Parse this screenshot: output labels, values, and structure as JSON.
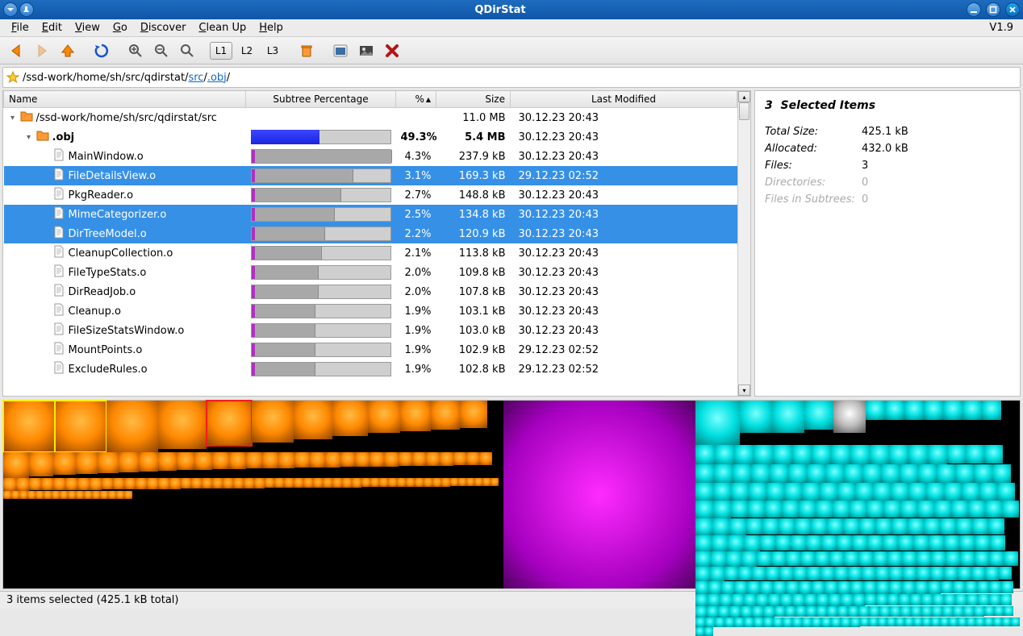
{
  "window": {
    "title": "QDirStat",
    "version": "V1.9"
  },
  "menu": {
    "file": "File",
    "edit": "Edit",
    "view": "View",
    "go": "Go",
    "discover": "Discover",
    "cleanup": "Clean Up",
    "help": "Help"
  },
  "toolbar": {
    "levels": {
      "l1": "L1",
      "l2": "L2",
      "l3": "L3"
    }
  },
  "breadcrumb": {
    "prefix": "/ssd-work/home/sh/src/qdirstat/",
    "link1": "src",
    "link2": ".obj",
    "trail": "/"
  },
  "columns": {
    "name": "Name",
    "subtree": "Subtree Percentage",
    "pct": "%",
    "size": "Size",
    "modified": "Last Modified"
  },
  "rows": [
    {
      "depth": 0,
      "expander": "down",
      "icon": "folder",
      "bold": false,
      "sel": false,
      "name": "/ssd-work/home/sh/src/qdirstat/src",
      "bar": null,
      "pct": "",
      "size": "11.0 MB",
      "mod": "30.12.23 20:43"
    },
    {
      "depth": 1,
      "expander": "down",
      "icon": "folder",
      "bold": true,
      "sel": false,
      "name": ".obj",
      "bar": {
        "type": "blue",
        "width": 49.3
      },
      "pct": "49.3%",
      "size": "5.4 MB",
      "mod": "30.12.23 20:43"
    },
    {
      "depth": 2,
      "expander": "",
      "icon": "file",
      "bold": false,
      "sel": false,
      "name": "MainWindow.o",
      "bar": {
        "type": "pg",
        "width": 4.3
      },
      "pct": "4.3%",
      "size": "237.9 kB",
      "mod": "30.12.23 20:43"
    },
    {
      "depth": 2,
      "expander": "",
      "icon": "file",
      "bold": false,
      "sel": true,
      "name": "FileDetailsView.o",
      "bar": {
        "type": "pg",
        "width": 3.1
      },
      "pct": "3.1%",
      "size": "169.3 kB",
      "mod": "29.12.23 02:52"
    },
    {
      "depth": 2,
      "expander": "",
      "icon": "file",
      "bold": false,
      "sel": false,
      "name": "PkgReader.o",
      "bar": {
        "type": "pg",
        "width": 2.7
      },
      "pct": "2.7%",
      "size": "148.8 kB",
      "mod": "30.12.23 20:43"
    },
    {
      "depth": 2,
      "expander": "",
      "icon": "file",
      "bold": false,
      "sel": true,
      "name": "MimeCategorizer.o",
      "bar": {
        "type": "pg",
        "width": 2.5
      },
      "pct": "2.5%",
      "size": "134.8 kB",
      "mod": "30.12.23 20:43"
    },
    {
      "depth": 2,
      "expander": "",
      "icon": "file",
      "bold": false,
      "sel": true,
      "name": "DirTreeModel.o",
      "bar": {
        "type": "pg",
        "width": 2.2
      },
      "pct": "2.2%",
      "size": "120.9 kB",
      "mod": "30.12.23 20:43"
    },
    {
      "depth": 2,
      "expander": "",
      "icon": "file",
      "bold": false,
      "sel": false,
      "name": "CleanupCollection.o",
      "bar": {
        "type": "pg",
        "width": 2.1
      },
      "pct": "2.1%",
      "size": "113.8 kB",
      "mod": "30.12.23 20:43"
    },
    {
      "depth": 2,
      "expander": "",
      "icon": "file",
      "bold": false,
      "sel": false,
      "name": "FileTypeStats.o",
      "bar": {
        "type": "pg",
        "width": 2.0
      },
      "pct": "2.0%",
      "size": "109.8 kB",
      "mod": "30.12.23 20:43"
    },
    {
      "depth": 2,
      "expander": "",
      "icon": "file",
      "bold": false,
      "sel": false,
      "name": "DirReadJob.o",
      "bar": {
        "type": "pg",
        "width": 2.0
      },
      "pct": "2.0%",
      "size": "107.8 kB",
      "mod": "30.12.23 20:43"
    },
    {
      "depth": 2,
      "expander": "",
      "icon": "file",
      "bold": false,
      "sel": false,
      "name": "Cleanup.o",
      "bar": {
        "type": "pg",
        "width": 1.9
      },
      "pct": "1.9%",
      "size": "103.1 kB",
      "mod": "30.12.23 20:43"
    },
    {
      "depth": 2,
      "expander": "",
      "icon": "file",
      "bold": false,
      "sel": false,
      "name": "FileSizeStatsWindow.o",
      "bar": {
        "type": "pg",
        "width": 1.9
      },
      "pct": "1.9%",
      "size": "103.0 kB",
      "mod": "30.12.23 20:43"
    },
    {
      "depth": 2,
      "expander": "",
      "icon": "file",
      "bold": false,
      "sel": false,
      "name": "MountPoints.o",
      "bar": {
        "type": "pg",
        "width": 1.9
      },
      "pct": "1.9%",
      "size": "102.9 kB",
      "mod": "29.12.23 02:52"
    },
    {
      "depth": 2,
      "expander": "",
      "icon": "file",
      "bold": false,
      "sel": false,
      "name": "ExcludeRules.o",
      "bar": {
        "type": "pg",
        "width": 1.9
      },
      "pct": "1.9%",
      "size": "102.8 kB",
      "mod": "29.12.23 02:52"
    }
  ],
  "details": {
    "title_count": "3",
    "title_label": "Selected Items",
    "total_size_k": "Total Size:",
    "total_size_v": "425.1 kB",
    "allocated_k": "Allocated:",
    "allocated_v": "432.0 kB",
    "files_k": "Files:",
    "files_v": "3",
    "dirs_k": "Directories:",
    "dirs_v": "0",
    "subfiles_k": "Files in Subtrees:",
    "subfiles_v": "0"
  },
  "status": "3 items selected (425.1 kB total)"
}
